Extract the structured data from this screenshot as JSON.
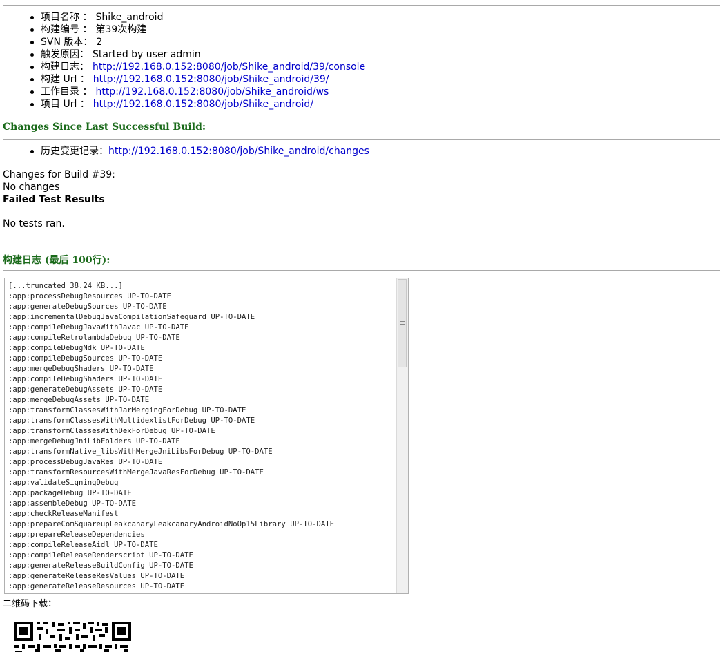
{
  "info": [
    {
      "label": "项目名称 ：",
      "value": "Shike_android",
      "link": false
    },
    {
      "label": "构建编号 ：",
      "value": "第39次构建",
      "link": false
    },
    {
      "label": "SVN 版本：",
      "value": "2",
      "link": false
    },
    {
      "label": "触发原因：",
      "value": "Started by user admin",
      "link": false
    },
    {
      "label": "构建日志：",
      "value": "http://192.168.0.152:8080/job/Shike_android/39/console",
      "link": true
    },
    {
      "label": "构建  Url ：",
      "value": "http://192.168.0.152:8080/job/Shike_android/39/",
      "link": true
    },
    {
      "label": "工作目录 ：",
      "value": "http://192.168.0.152:8080/job/Shike_android/ws",
      "link": true
    },
    {
      "label": "项目  Url ：",
      "value": "http://192.168.0.152:8080/job/Shike_android/",
      "link": true
    }
  ],
  "changes": {
    "title": "Changes Since Last Successful Build:",
    "history_label": "历史变更记录：",
    "history_url": "http://192.168.0.152:8080/job/Shike_android/changes",
    "build_line": "Changes for Build #39:",
    "no_changes": "No changes"
  },
  "tests": {
    "title": "Failed Test Results",
    "result": "No tests ran."
  },
  "log": {
    "title": "构建日志 (最后 100行):",
    "lines": [
      "[...truncated 38.24 KB...]",
      ":app:processDebugResources UP-TO-DATE",
      ":app:generateDebugSources UP-TO-DATE",
      ":app:incrementalDebugJavaCompilationSafeguard UP-TO-DATE",
      ":app:compileDebugJavaWithJavac UP-TO-DATE",
      ":app:compileRetrolambdaDebug UP-TO-DATE",
      ":app:compileDebugNdk UP-TO-DATE",
      ":app:compileDebugSources UP-TO-DATE",
      ":app:mergeDebugShaders UP-TO-DATE",
      ":app:compileDebugShaders UP-TO-DATE",
      ":app:generateDebugAssets UP-TO-DATE",
      ":app:mergeDebugAssets UP-TO-DATE",
      ":app:transformClassesWithJarMergingForDebug UP-TO-DATE",
      ":app:transformClassesWithMultidexlistForDebug UP-TO-DATE",
      ":app:transformClassesWithDexForDebug UP-TO-DATE",
      ":app:mergeDebugJniLibFolders UP-TO-DATE",
      ":app:transformNative_libsWithMergeJniLibsForDebug UP-TO-DATE",
      ":app:processDebugJavaRes UP-TO-DATE",
      ":app:transformResourcesWithMergeJavaResForDebug UP-TO-DATE",
      ":app:validateSigningDebug",
      ":app:packageDebug UP-TO-DATE",
      ":app:assembleDebug UP-TO-DATE",
      ":app:checkReleaseManifest",
      ":app:prepareComSquareupLeakcanaryLeakcanaryAndroidNoOp15Library UP-TO-DATE",
      ":app:prepareReleaseDependencies",
      ":app:compileReleaseAidl UP-TO-DATE",
      ":app:compileReleaseRenderscript UP-TO-DATE",
      ":app:generateReleaseBuildConfig UP-TO-DATE",
      ":app:generateReleaseResValues UP-TO-DATE",
      ":app:generateReleaseResources UP-TO-DATE"
    ]
  },
  "qr": {
    "label": "二维码下载：",
    "icon": "qr-code-icon"
  }
}
